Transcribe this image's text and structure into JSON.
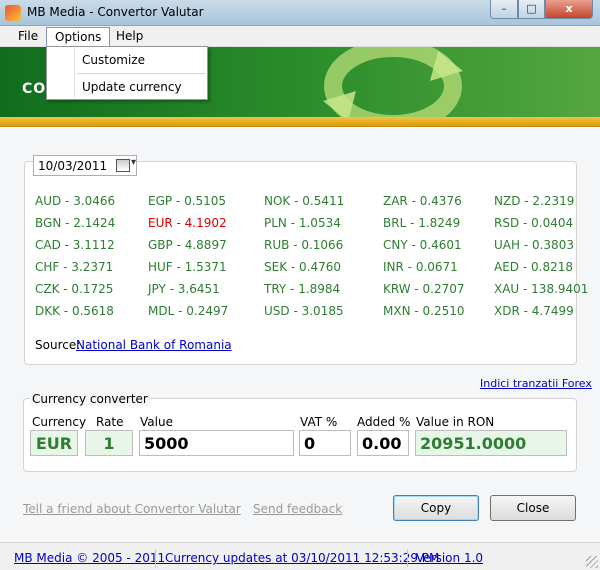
{
  "window": {
    "title": "MB Media - Convertor Valutar",
    "min_label": "–",
    "max_label": "□",
    "close_label": "x"
  },
  "menu": {
    "file": "File",
    "options": "Options",
    "help": "Help"
  },
  "options_menu": {
    "customize": "Customize",
    "update_currency": "Update currency"
  },
  "banner": {
    "text": "CO"
  },
  "date": "10/03/2011",
  "rates": [
    [
      "AUD - 3.0466",
      "EGP - 0.5105",
      "NOK - 0.5411",
      "ZAR - 0.4376",
      "NZD - 2.2319"
    ],
    [
      "BGN - 2.1424",
      "EUR - 4.1902",
      "PLN - 1.0534",
      "BRL - 1.8249",
      "RSD - 0.0404"
    ],
    [
      "CAD - 3.1112",
      "GBP - 4.8897",
      "RUB - 0.1066",
      "CNY - 0.4601",
      "UAH - 0.3803"
    ],
    [
      "CHF - 3.2371",
      "HUF - 1.5371",
      "SEK - 0.4760",
      "INR - 0.0671",
      "AED - 0.8218"
    ],
    [
      "CZK - 0.1725",
      "JPY - 3.6451",
      "TRY - 1.8984",
      "KRW - 0.2707",
      "XAU - 138.9401"
    ],
    [
      "DKK - 0.5618",
      "MDL - 0.2497",
      "USD - 3.0185",
      "MXN - 0.2510",
      "XDR - 4.7499"
    ]
  ],
  "highlight_color": "#e00000",
  "rate_color": "#2e7d32",
  "source": {
    "label": "Source:",
    "link": "National Bank of Romania"
  },
  "forex_link": "Indici tranzatii Forex",
  "converter": {
    "title": "Currency converter",
    "headers": {
      "currency": "Currency",
      "rate": "Rate",
      "value": "Value",
      "vat": "VAT %",
      "added": "Added %",
      "ron": "Value in RON"
    },
    "currency": "EUR",
    "rate": "1",
    "value": "5000",
    "vat": "0",
    "added": "0.00",
    "ron": "20951.0000"
  },
  "footer_links": {
    "tell": "Tell a friend about Convertor Valutar",
    "feedback": "Send feedback"
  },
  "buttons": {
    "copy": "Copy",
    "close": "Close"
  },
  "status": {
    "copyright": "MB Media © 2005 - 2011",
    "updates": "Currency updates at 03/10/2011 12:53:29 PM",
    "version": "Version 1.0"
  }
}
